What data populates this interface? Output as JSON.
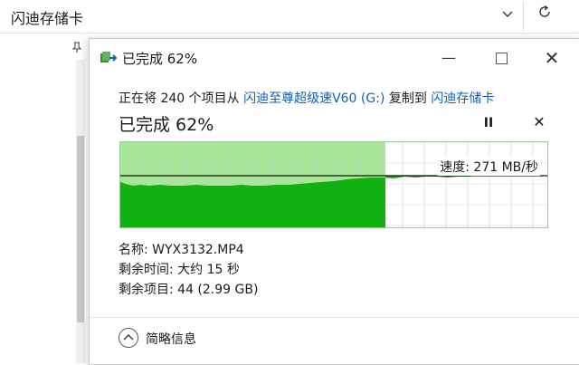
{
  "explorer": {
    "path": "闪迪存储卡",
    "dropdown_icon": "chevron-down-icon",
    "refresh_icon": "refresh-icon",
    "pin_icon": "pin-icon"
  },
  "dialog": {
    "title": "已完成 62%",
    "title_icon": "copy-files-icon",
    "window_buttons": {
      "minimize": "—",
      "close": "✕"
    },
    "copy_line": {
      "prefix": "正在将 240 个项目从 ",
      "source": "闪迪至尊超级速V60 (G:)",
      "middle": " 复制到 ",
      "destination": "闪迪存储卡"
    },
    "status": "已完成 62%",
    "pause_label": "II",
    "cancel_label": "✕",
    "progress_percent": 62,
    "speed": "速度: 271 MB/秒",
    "details": {
      "name_label": "名称:",
      "name_value": "WYX3132.MP4",
      "time_label": "剩余时间:",
      "time_value": "大约 15 秒",
      "items_label": "剩余项目:",
      "items_value": "44 (2.99 GB)"
    },
    "more_info": "简略信息"
  },
  "colors": {
    "progress_fill": "#a6e696",
    "speed_fill": "#11b111",
    "link": "#0f5fb8",
    "grid": "#cfcfcf"
  }
}
